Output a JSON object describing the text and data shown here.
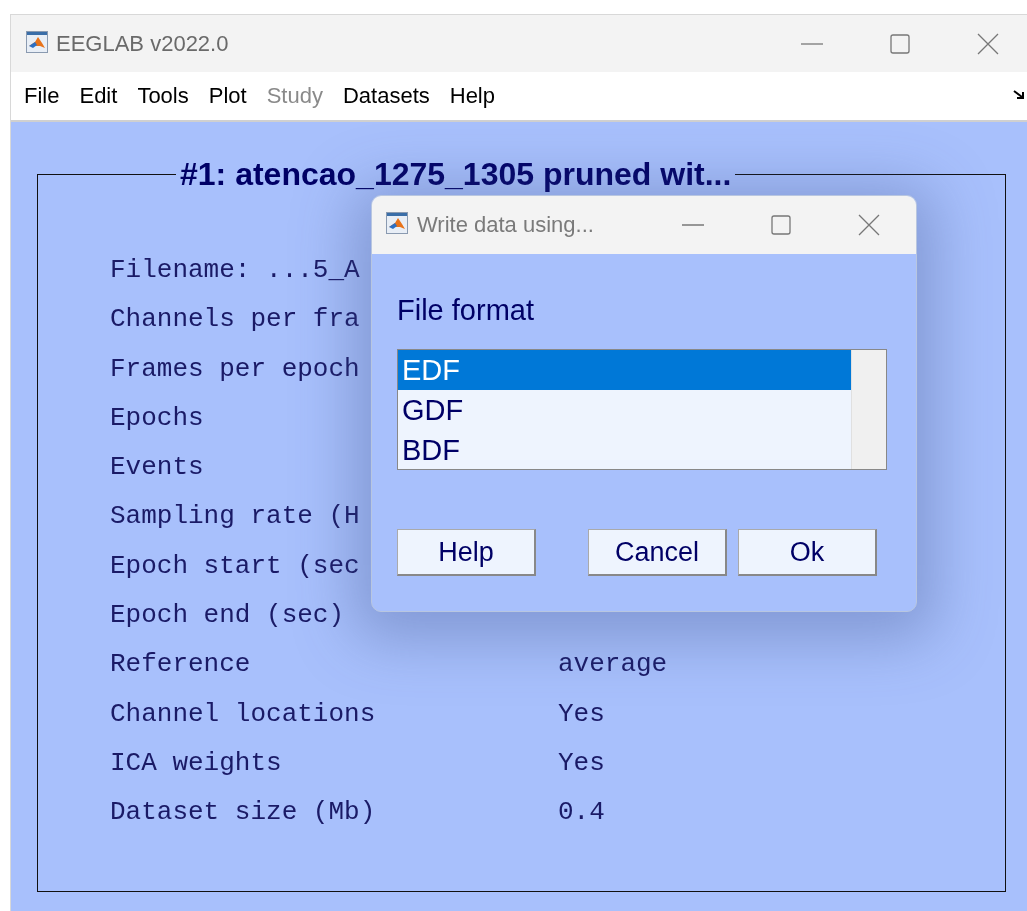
{
  "window": {
    "title": "EEGLAB v2022.0"
  },
  "menu": [
    {
      "label": "File",
      "disabled": false
    },
    {
      "label": "Edit",
      "disabled": false
    },
    {
      "label": "Tools",
      "disabled": false
    },
    {
      "label": "Plot",
      "disabled": false
    },
    {
      "label": "Study",
      "disabled": true
    },
    {
      "label": "Datasets",
      "disabled": false
    },
    {
      "label": "Help",
      "disabled": false
    }
  ],
  "panel": {
    "title": "#1: atencao_1275_1305 pruned wit...",
    "rows": [
      {
        "label": "Filename: ...5_A"
      },
      {
        "label": "Channels per fra"
      },
      {
        "label": "Frames per epoch"
      },
      {
        "label": "Epochs"
      },
      {
        "label": "Events"
      },
      {
        "label": "Sampling rate (H"
      },
      {
        "label": "Epoch start (sec"
      },
      {
        "label": "Epoch end (sec)"
      },
      {
        "label": "Reference",
        "value": "average"
      },
      {
        "label": "Channel locations",
        "value": "Yes"
      },
      {
        "label": "ICA weights",
        "value": "Yes"
      },
      {
        "label": "Dataset size (Mb)",
        "value": "0.4"
      }
    ]
  },
  "dialog": {
    "title": "Write data using...",
    "label": "File format",
    "options": [
      {
        "label": "EDF",
        "selected": true
      },
      {
        "label": "GDF",
        "selected": false
      },
      {
        "label": "BDF",
        "selected": false
      }
    ],
    "buttons": [
      "Help",
      "Cancel",
      "Ok"
    ]
  }
}
